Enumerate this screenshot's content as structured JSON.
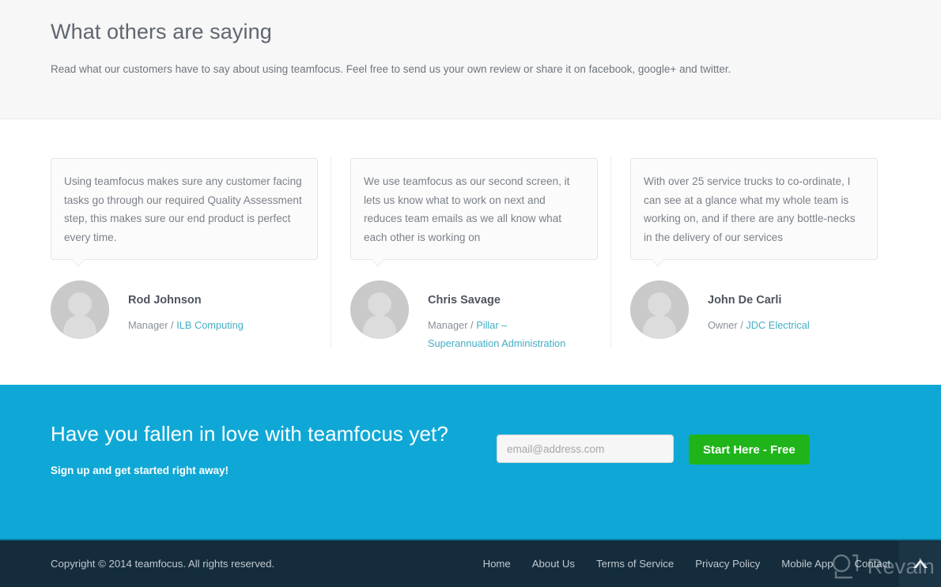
{
  "intro": {
    "title": "What others are saying",
    "subtitle": "Read what our customers have to say about using teamfocus. Feel free to send us your own review or share it on facebook, google+ and twitter."
  },
  "testimonials": [
    {
      "quote": "Using teamfocus makes sure any customer facing tasks go through our required Quality Assessment step, this makes sure our end product is perfect every time.",
      "name": "Rod Johnson",
      "role": "Manager /",
      "company": "ILB Computing"
    },
    {
      "quote": "We use teamfocus as our second screen, it lets us know what to work on next and reduces team emails as we all know what each other is working on",
      "name": "Chris Savage",
      "role": "Manager /",
      "company": "Pillar – Superannuation Administration"
    },
    {
      "quote": "With over 25 service trucks to co-ordinate, I can see at a glance what my whole team is working on, and if there are any bottle-necks in the delivery of our services",
      "name": "John De Carli",
      "role": "Owner /",
      "company": "JDC Electrical"
    }
  ],
  "cta": {
    "title": "Have you fallen in love with teamfocus yet?",
    "subtitle": "Sign up and get started right away!",
    "email_value": "",
    "email_placeholder": "email@address.com",
    "button_label": "Start Here - Free",
    "background_color": "#0fa8d6",
    "button_color": "#1fb51a"
  },
  "footer": {
    "copyright": "Copyright © 2014 teamfocus. All rights reserved.",
    "links": [
      {
        "label": "Home"
      },
      {
        "label": "About Us"
      },
      {
        "label": "Terms of Service"
      },
      {
        "label": "Privacy Policy"
      },
      {
        "label": "Mobile App"
      },
      {
        "label": "Contact"
      }
    ],
    "background_color": "#142c3c"
  },
  "watermark": {
    "text": "Revain"
  }
}
